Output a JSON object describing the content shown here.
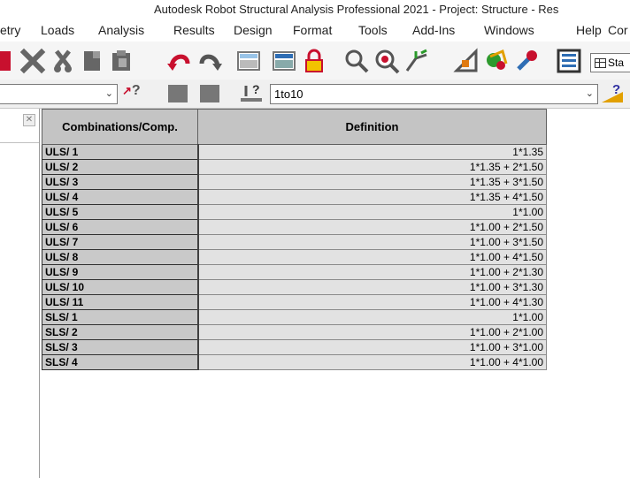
{
  "window": {
    "title": "Autodesk Robot Structural Analysis Professional 2021 - Project: Structure - Res"
  },
  "menu": {
    "items": [
      "etry",
      "Loads",
      "Analysis",
      "Results",
      "Design",
      "Format",
      "Tools",
      "Add-Ins",
      "Windows",
      "Help",
      "Cor"
    ]
  },
  "toolbar": {
    "stage_label": "Sta",
    "icons": [
      "delete-icon",
      "cut-icon",
      "copy-icon",
      "paste-icon",
      "undo-icon",
      "redo-icon",
      "calculator-icon",
      "calculations-icon",
      "lock-icon",
      "zoom-icon",
      "zoom-in-icon",
      "structure-model-icon",
      "section-definition-icon",
      "display-icon",
      "tools-icon",
      "tables-icon"
    ]
  },
  "selection_bar": {
    "object_select_value": "",
    "case_select_value": "1to10",
    "help_query": "?",
    "case_query": "?"
  },
  "table": {
    "headers": [
      "Combinations/Comp.",
      "Definition"
    ],
    "rows": [
      {
        "name": "ULS/ 1",
        "definition": "1*1.35"
      },
      {
        "name": "ULS/ 2",
        "definition": "1*1.35 + 2*1.50"
      },
      {
        "name": "ULS/ 3",
        "definition": "1*1.35 + 3*1.50"
      },
      {
        "name": "ULS/ 4",
        "definition": "1*1.35 + 4*1.50"
      },
      {
        "name": "ULS/ 5",
        "definition": "1*1.00"
      },
      {
        "name": "ULS/ 6",
        "definition": "1*1.00 + 2*1.50"
      },
      {
        "name": "ULS/ 7",
        "definition": "1*1.00 + 3*1.50"
      },
      {
        "name": "ULS/ 8",
        "definition": "1*1.00 + 4*1.50"
      },
      {
        "name": "ULS/ 9",
        "definition": "1*1.00 + 2*1.30"
      },
      {
        "name": "ULS/ 10",
        "definition": "1*1.00 + 3*1.30"
      },
      {
        "name": "ULS/ 11",
        "definition": "1*1.00 + 4*1.30"
      },
      {
        "name": "SLS/ 1",
        "definition": "1*1.00"
      },
      {
        "name": "SLS/ 2",
        "definition": "1*1.00 + 2*1.00"
      },
      {
        "name": "SLS/ 3",
        "definition": "1*1.00 + 3*1.00"
      },
      {
        "name": "SLS/ 4",
        "definition": "1*1.00 + 4*1.00"
      }
    ]
  }
}
